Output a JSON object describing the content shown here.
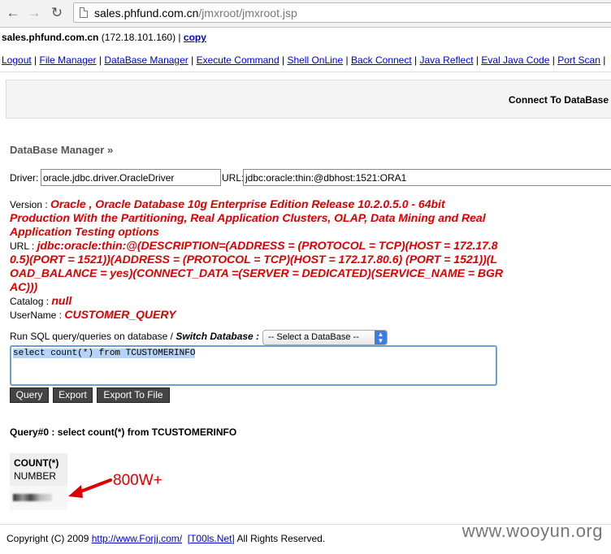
{
  "browser": {
    "url_host": "sales.phfund.com.cn",
    "url_path": "/jmxroot/jmxroot.jsp",
    "back_icon": "arrow-left-icon",
    "forward_icon": "arrow-right-icon",
    "reload_icon": "reload-icon"
  },
  "hostline": {
    "host": "sales.phfund.com.cn",
    "ip": " (172.18.101.160) | ",
    "copy": "copy"
  },
  "menu": [
    "Logout",
    "File Manager",
    "DataBase Manager",
    "Execute Command",
    "Shell OnLine",
    "Back Connect",
    "Java Reflect",
    "Eval Java Code",
    "Port Scan"
  ],
  "connect_bar": "Connect To DataBase",
  "db_title": "DataBase Manager »",
  "driver": {
    "driver_label": "Driver:",
    "driver_value": "oracle.jdbc.driver.OracleDriver",
    "url_label": "URL:",
    "url_value": "jdbc:oracle:thin:@dbhost:1521:ORA1"
  },
  "info": {
    "version_label": "Version :",
    "version_value": "Oracle , Oracle Database 10g Enterprise Edition Release 10.2.0.5.0 - 64bit Production With the Partitioning, Real Application Clusters, OLAP, Data Mining and Real Application Testing options",
    "url_label": "URL :",
    "url_value": "jdbc:oracle:thin:@(DESCRIPTION=(ADDRESS = (PROTOCOL = TCP)(HOST = 172.17.80.5)(PORT = 1521))(ADDRESS = (PROTOCOL = TCP)(HOST = 172.17.80.6) (PORT = 1521))(LOAD_BALANCE = yes)(CONNECT_DATA =(SERVER = DEDICATED)(SERVICE_NAME = BGRAC)))",
    "catalog_label": "Catalog :",
    "catalog_value": "null",
    "user_label": "UserName :",
    "user_value": "CUSTOMER_QUERY"
  },
  "sql": {
    "prompt": "Run SQL query/queries on database / ",
    "switch_label": "Switch Database :",
    "select_value": "-- Select a DataBase --",
    "query_text": "select count(*) from TCUSTOMERINFO"
  },
  "buttons": {
    "query": "Query",
    "export": "Export",
    "export_file": "Export To File"
  },
  "result": {
    "title": "Query#0 : select count(*) from TCUSTOMERINFO",
    "col_name": "COUNT(*)",
    "col_type": "NUMBER"
  },
  "annotation": "800W+",
  "footer": {
    "prefix": "Copyright (C) 2009 ",
    "link1": "http://www.Forjj.com/",
    "link2": "[T00ls.Net]",
    "suffix": " All Rights Reserved."
  },
  "watermark": "www.wooyun.org",
  "colors": {
    "accent_red": "#dd0000",
    "link_blue": "#0000cc"
  }
}
